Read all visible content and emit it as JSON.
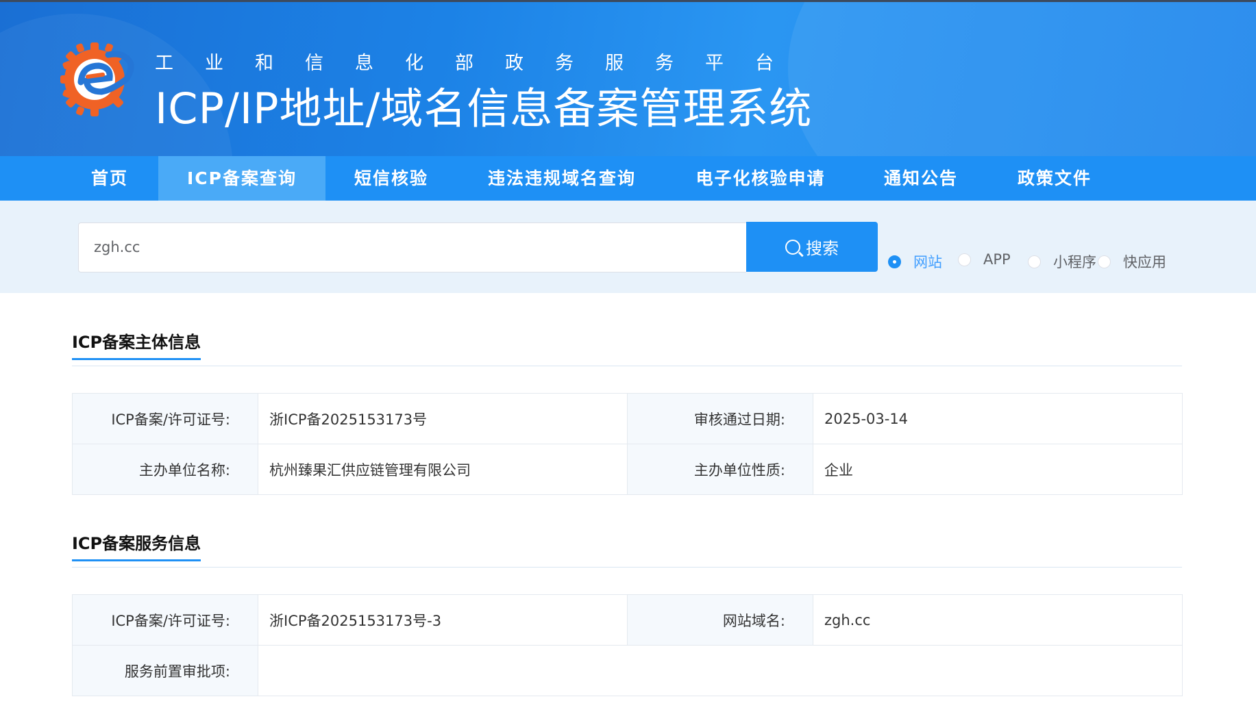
{
  "header": {
    "subtitle": "工业和信息化部政务服务平台",
    "title": "ICP/IP地址/域名信息备案管理系统"
  },
  "nav": {
    "items": [
      {
        "label": "首页",
        "active": false
      },
      {
        "label": "ICP备案查询",
        "active": true
      },
      {
        "label": "短信核验",
        "active": false
      },
      {
        "label": "违法违规域名查询",
        "active": false
      },
      {
        "label": "电子化核验申请",
        "active": false
      },
      {
        "label": "通知公告",
        "active": false
      },
      {
        "label": "政策文件",
        "active": false
      }
    ]
  },
  "search": {
    "value": "zgh.cc",
    "button_label": "搜索",
    "types": [
      {
        "label": "网站",
        "checked": true
      },
      {
        "label": "APP",
        "checked": false
      },
      {
        "label": "小程序",
        "checked": false
      },
      {
        "label": "快应用",
        "checked": false
      }
    ]
  },
  "subject_info": {
    "title": "ICP备案主体信息",
    "rows": [
      [
        {
          "label": "ICP备案/许可证号:",
          "value": "浙ICP备2025153173号"
        },
        {
          "label": "审核通过日期:",
          "value": "2025-03-14"
        }
      ],
      [
        {
          "label": "主办单位名称:",
          "value": "杭州臻果汇供应链管理有限公司"
        },
        {
          "label": "主办单位性质:",
          "value": "企业"
        }
      ]
    ]
  },
  "service_info": {
    "title": "ICP备案服务信息",
    "rows": [
      [
        {
          "label": "ICP备案/许可证号:",
          "value": "浙ICP备2025153173号-3"
        },
        {
          "label": "网站域名:",
          "value": "zgh.cc"
        }
      ],
      [
        {
          "label": "服务前置审批项:",
          "value": ""
        }
      ]
    ]
  },
  "colors": {
    "primary": "#1e90f5",
    "nav_active": "#4aaaf7",
    "search_band": "#e8f2fb",
    "logo_orange": "#f05a1a"
  }
}
